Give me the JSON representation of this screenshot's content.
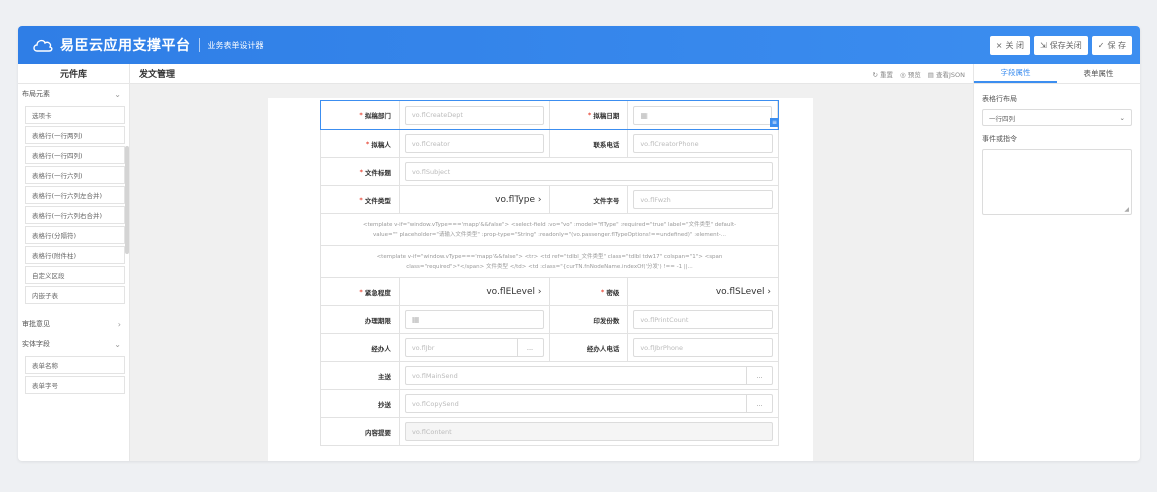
{
  "app": {
    "title": "易臣云应用支撑平台",
    "subtitle": "业务表单设计器",
    "buttons": [
      {
        "icon": "close-icon",
        "glyph": "×",
        "label": "关 闭"
      },
      {
        "icon": "save-close-icon",
        "glyph": "⇲",
        "label": "保存关闭"
      },
      {
        "icon": "check-icon",
        "glyph": "✓",
        "label": "保 存"
      }
    ]
  },
  "sidebar": {
    "title": "元件库",
    "groups": [
      {
        "label": "布局元素",
        "expanded": true,
        "items": [
          "选项卡",
          "表格行(一行两列)",
          "表格行(一行四列)",
          "表格行(一行六列)",
          "表格行(一行六列左合并)",
          "表格行(一行六列右合并)",
          "表格行(分隔符)",
          "表格行(附件柱)",
          "自定义区段",
          "内嵌子表"
        ]
      },
      {
        "label": "审批意见",
        "expanded": false,
        "items": []
      },
      {
        "label": "实体字段",
        "expanded": true,
        "items": [
          "表单名称",
          "表单字号"
        ]
      }
    ]
  },
  "canvas": {
    "title": "发文管理",
    "actions": [
      {
        "icon": "reset-icon",
        "glyph": "↻",
        "label": "重置"
      },
      {
        "icon": "preview-icon",
        "glyph": "◎",
        "label": "预览"
      },
      {
        "icon": "json-icon",
        "glyph": "▤",
        "label": "查看JSON"
      }
    ]
  },
  "form": {
    "create_dept": {
      "label": "拟稿部门",
      "placeholder": "vo.flCreateDept"
    },
    "create_date": {
      "label": "拟稿日期",
      "icon": "calendar-icon"
    },
    "creator": {
      "label": "拟稿人",
      "placeholder": "vo.flCreator"
    },
    "creator_phone": {
      "label": "联系电话",
      "placeholder": "vo.flCreatorPhone"
    },
    "subject": {
      "label": "文件标题",
      "placeholder": "vo.flSubject"
    },
    "file_type": {
      "label": "文件类型",
      "value": "vo.flType"
    },
    "file_no": {
      "label": "文件字号",
      "placeholder": "vo.flFwzh"
    },
    "template1": [
      "<template v-if=\"window.vType==='mapp'&&false\"> <select-field :vo=\"vo\" :model=\"flType\" :required=\"true\" label=\"文件类型\" default-",
      "value=\"\" placeholder=\"请输入文件类型\" :prop-type=\"String\" :readonly=\"(vo.passenger.flTypeOptions!==undefined)\" :element-..."
    ],
    "template2": [
      "<template v-if=\"window.vType==='mapp'&&false\"> <tr> <td ref=\"tdlbl_文件类型\" class=\"tdlbl tdw17\" colspan=\"1\"> <span",
      "class=\"required\">*</span> 文件类型 </td> <td :class=\"{curTN.fnNodeName.indexOf('分发') !== -1 ||..."
    ],
    "urgency": {
      "label": "紧急程度",
      "value": "vo.flELevel"
    },
    "secret": {
      "label": "密级",
      "value": "vo.flSLevel"
    },
    "deadline": {
      "label": "办理期限",
      "icon": "calendar-icon"
    },
    "print_count": {
      "label": "印发份数",
      "placeholder": "vo.flPrintCount"
    },
    "handler": {
      "label": "经办人",
      "placeholder": "vo.flJbr",
      "btn": "..."
    },
    "handler_phone": {
      "label": "经办人电话",
      "placeholder": "vo.flJbrPhone"
    },
    "main_send": {
      "label": "主送",
      "placeholder": "vo.flMainSend",
      "btn": "..."
    },
    "copy_send": {
      "label": "抄送",
      "placeholder": "vo.flCopySend",
      "btn": "..."
    },
    "content": {
      "label": "内容提要",
      "placeholder": "vo.flContent"
    }
  },
  "props": {
    "tabs": [
      "字段属性",
      "表单属性"
    ],
    "active_tab": 0,
    "layout_label": "表格行布局",
    "layout_value": "一行四列",
    "event_label": "事件或指令"
  }
}
